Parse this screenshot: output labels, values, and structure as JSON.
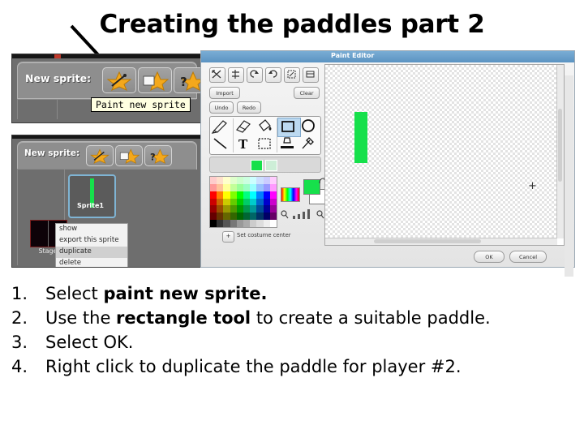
{
  "slide": {
    "title": "Creating the paddles part 2"
  },
  "sprite_toolbar": {
    "label": "New sprite:",
    "buttons": [
      {
        "name": "paint-new-sprite",
        "icon": "star-brush-icon"
      },
      {
        "name": "choose-new-sprite",
        "icon": "star-folder-icon"
      },
      {
        "name": "random-new-sprite",
        "icon": "star-question-icon"
      }
    ],
    "tooltip": "Paint new sprite"
  },
  "sprite_panel": {
    "label": "New sprite:",
    "stage_caption": "Stage",
    "sprite_caption": "Sprite1",
    "context_menu": [
      {
        "label": "show",
        "selected": false
      },
      {
        "label": "export this sprite",
        "selected": false
      },
      {
        "label": "duplicate",
        "selected": true
      },
      {
        "label": "delete",
        "selected": false
      }
    ]
  },
  "paint_editor": {
    "title": "Paint Editor",
    "transform_buttons": [
      "flip-horizontal-icon",
      "flip-vertical-icon",
      "rotate-left-icon",
      "rotate-right-icon",
      "grow-icon",
      "shrink-icon"
    ],
    "import_label": "Import",
    "clear_label": "Clear",
    "undo_label": "Undo",
    "redo_label": "Redo",
    "tools": [
      {
        "name": "brush-tool",
        "selected": false
      },
      {
        "name": "eraser-tool",
        "selected": false
      },
      {
        "name": "fill-tool",
        "selected": false
      },
      {
        "name": "rectangle-tool",
        "selected": true
      },
      {
        "name": "ellipse-tool",
        "selected": false
      },
      {
        "name": "line-tool",
        "selected": false
      },
      {
        "name": "text-tool",
        "selected": false
      },
      {
        "name": "select-tool",
        "selected": false
      },
      {
        "name": "stamp-tool",
        "selected": false
      },
      {
        "name": "eyedropper-tool",
        "selected": false
      }
    ],
    "foreground_color": "#16e04b",
    "background_color": "#ffffff",
    "set_costume_center_label": "Set costume center",
    "costume_center_icon": "+",
    "canvas_marker": "+",
    "ok_label": "OK",
    "cancel_label": "Cancel",
    "palette_colors": [
      "#ffcccc",
      "#ffe0cc",
      "#ffffcc",
      "#e0ffcc",
      "#ccffcc",
      "#ccffe0",
      "#ccffff",
      "#cce0ff",
      "#ccccff",
      "#ffccff",
      "#ff9999",
      "#ffc299",
      "#ffff99",
      "#c2ff99",
      "#99ff99",
      "#99ffc2",
      "#99ffff",
      "#99c2ff",
      "#9999ff",
      "#ff99ff",
      "#ff0000",
      "#ff8000",
      "#ffff00",
      "#80ff00",
      "#00ff00",
      "#00ff80",
      "#00ffff",
      "#0080ff",
      "#0000ff",
      "#ff00ff",
      "#cc0000",
      "#cc6600",
      "#cccc00",
      "#66cc00",
      "#00cc00",
      "#00cc66",
      "#00cccc",
      "#0066cc",
      "#0000cc",
      "#cc00cc",
      "#990000",
      "#994d00",
      "#999900",
      "#4d9900",
      "#009900",
      "#00994d",
      "#009999",
      "#004d99",
      "#000099",
      "#990099",
      "#660000",
      "#663300",
      "#666600",
      "#336600",
      "#006600",
      "#006633",
      "#006666",
      "#003366",
      "#000066",
      "#660066",
      "#000000",
      "#333333",
      "#555555",
      "#777777",
      "#999999",
      "#aaaaaa",
      "#cccccc",
      "#dddddd",
      "#eeeeee",
      "#ffffff"
    ]
  },
  "steps": [
    {
      "num": "1.",
      "pre": "Select ",
      "bold": "paint new sprite.",
      "post": ""
    },
    {
      "num": "2.",
      "pre": "Use the ",
      "bold": "rectangle tool",
      "post": " to create a suitable paddle."
    },
    {
      "num": "3.",
      "pre": "Select OK.",
      "bold": "",
      "post": ""
    },
    {
      "num": "4.",
      "pre": "Right click to duplicate the paddle for player #2.",
      "bold": "",
      "post": ""
    }
  ]
}
